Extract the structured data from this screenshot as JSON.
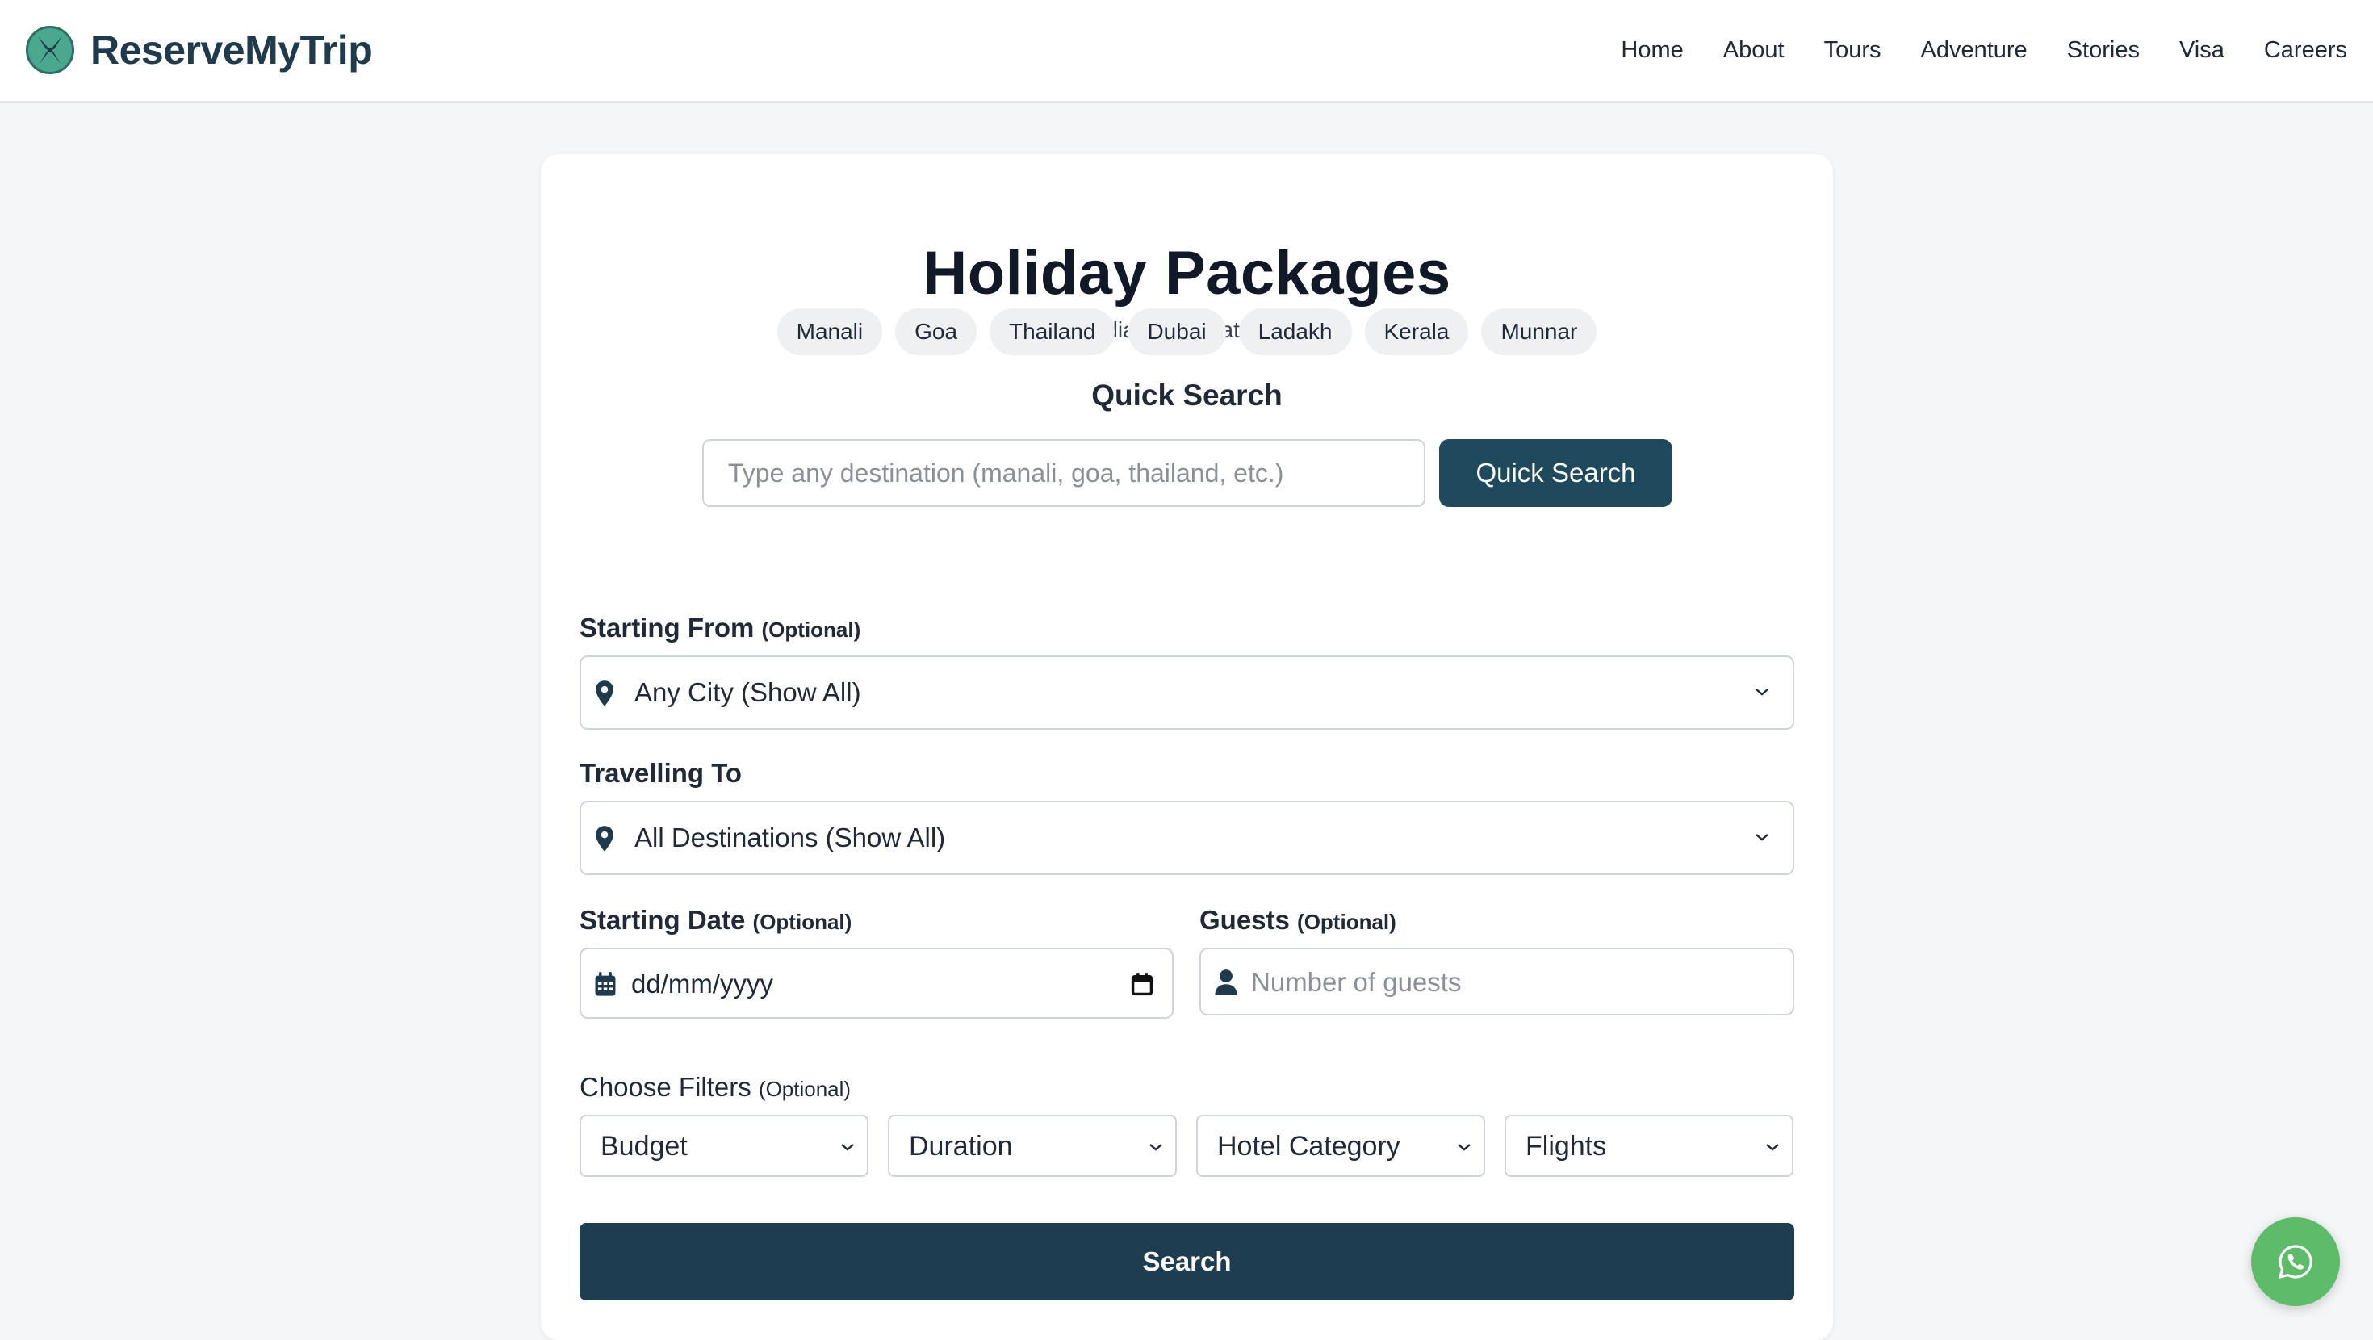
{
  "header": {
    "brand_name": "ReserveMyTrip",
    "logo_icon": "butterfly-leaf-logo",
    "nav": [
      "Home",
      "About",
      "Tours",
      "Adventure",
      "Stories",
      "Visa",
      "Careers"
    ]
  },
  "page": {
    "title": "Holiday Packages",
    "subtitle": "India & International"
  },
  "quick_search": {
    "heading": "Quick Search",
    "placeholder": "Type any destination (manali, goa, thailand, etc.)",
    "value": "",
    "button_label": "Quick Search",
    "chips": [
      "Manali",
      "Goa",
      "Thailand",
      "Dubai",
      "Ladakh",
      "Kerala",
      "Munnar"
    ]
  },
  "form": {
    "starting_from": {
      "label": "Starting From",
      "optional": "(Optional)",
      "selected": "Any City (Show All)",
      "icon": "map-pin-icon"
    },
    "travelling_to": {
      "label": "Travelling To",
      "selected": "All Destinations (Show All)",
      "icon": "map-pin-icon"
    },
    "starting_date": {
      "label": "Starting Date",
      "optional": "(Optional)",
      "value": "dd/mm/yyyy",
      "icon": "calendar-icon"
    },
    "guests": {
      "label": "Guests",
      "optional": "(Optional)",
      "placeholder": "Number of guests",
      "icon": "user-icon"
    },
    "filters": {
      "label": "Choose Filters",
      "optional": "(Optional)",
      "items": [
        "Budget",
        "Duration",
        "Hotel Category",
        "Flights"
      ]
    },
    "search_label": "Search"
  },
  "colors": {
    "brand": "#1e3a4c",
    "primary_button": "#1e3d50",
    "quick_button": "#1f4a5e",
    "whatsapp": "#5dbb6a",
    "page_bg": "#f5f6f7"
  },
  "floating": {
    "whatsapp_icon": "whatsapp-icon"
  }
}
